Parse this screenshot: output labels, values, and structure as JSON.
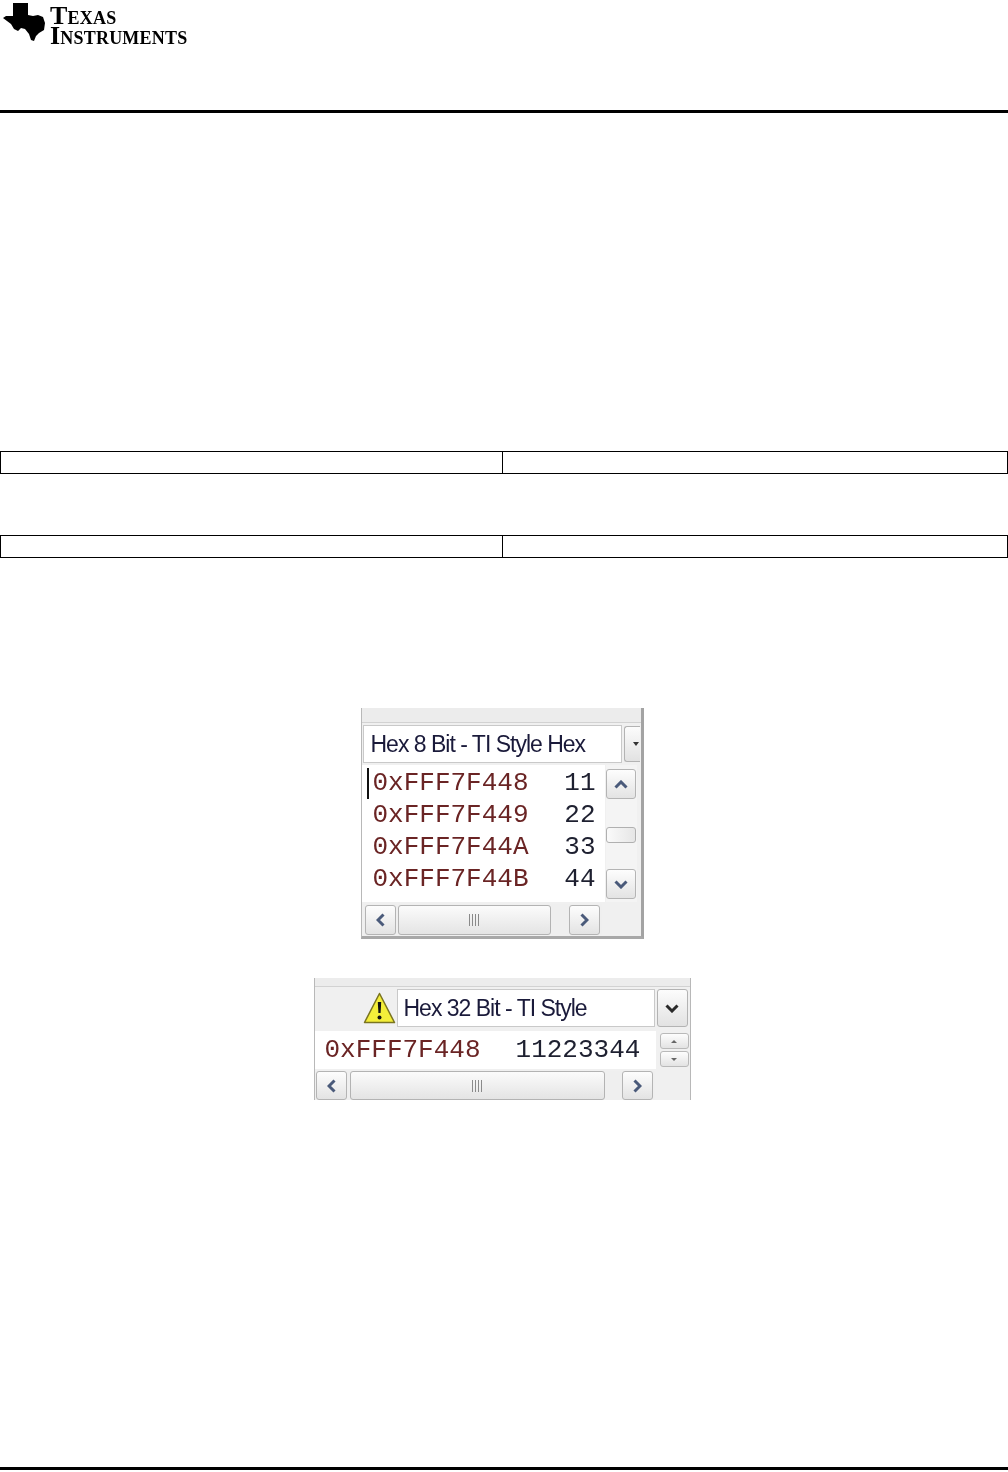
{
  "header": {
    "logo_lines": [
      "TEXAS",
      "INSTRUMENTS"
    ]
  },
  "memory_view_8bit": {
    "format": "Hex 8 Bit - TI Style Hex",
    "rows": [
      {
        "address": "0xFFF7F448",
        "value": "11",
        "caret": true
      },
      {
        "address": "0xFFF7F449",
        "value": "22",
        "caret": false
      },
      {
        "address": "0xFFF7F44A",
        "value": "33",
        "caret": false
      },
      {
        "address": "0xFFF7F44B",
        "value": "44",
        "caret": false
      }
    ]
  },
  "memory_view_32bit": {
    "warning": true,
    "format": "Hex 32 Bit - TI Style",
    "rows": [
      {
        "address": "0xFFF7F448",
        "value": "11223344"
      }
    ]
  }
}
